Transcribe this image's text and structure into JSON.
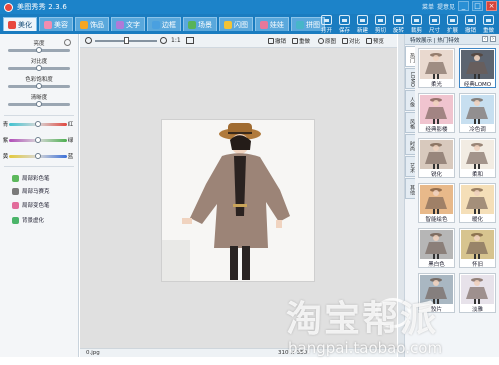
{
  "window": {
    "title": "美图秀秀 2.3.6",
    "menu_label": "菜单",
    "feedback_label": "提意见",
    "minimize": "_",
    "maximize": "□",
    "close": "×"
  },
  "tabs": [
    {
      "label": "美化",
      "color": "#e8483e",
      "active": true
    },
    {
      "label": "美容",
      "color": "#f08db0",
      "active": false
    },
    {
      "label": "饰品",
      "color": "#f5a623",
      "active": false
    },
    {
      "label": "文字",
      "color": "#b07ad8",
      "active": false
    },
    {
      "label": "边框",
      "color": "#4aa0e0",
      "active": false
    },
    {
      "label": "场景",
      "color": "#58b35a",
      "active": false
    },
    {
      "label": "闪图",
      "color": "#f2c335",
      "active": false
    },
    {
      "label": "娃娃",
      "color": "#e8789a",
      "active": false
    },
    {
      "label": "拼图",
      "color": "#47b6c9",
      "active": false
    }
  ],
  "tools": [
    "打开",
    "保存",
    "新建",
    "剪切",
    "旋转",
    "裁剪",
    "尺寸",
    "扩展",
    "撤销",
    "重做"
  ],
  "left_panel": {
    "sliders": [
      {
        "label": "亮度",
        "value": 0.5
      },
      {
        "label": "对比度",
        "value": 0.5
      },
      {
        "label": "色彩饱和度",
        "value": 0.5
      },
      {
        "label": "清晰度",
        "value": 0.5
      }
    ],
    "color_balance": [
      {
        "left": "青",
        "right": "红",
        "value": 0.5
      },
      {
        "left": "紫",
        "right": "绿",
        "value": 0.5
      },
      {
        "left": "黄",
        "right": "蓝",
        "value": 0.5
      }
    ],
    "effects": [
      {
        "label": "局部彩色笔",
        "color": "#5cb85c"
      },
      {
        "label": "局部马赛克",
        "color": "#7a7a7a"
      },
      {
        "label": "局部变色笔",
        "color": "#e26c9b"
      },
      {
        "label": "背景虚化",
        "color": "#4bb56a"
      }
    ]
  },
  "canvas_toolbar": {
    "ratio": "1:1",
    "undo": "撤销",
    "redo": "重做",
    "original": "原图",
    "compare": "对比",
    "preview": "预览"
  },
  "status": {
    "filename": "0.jpg",
    "size": "310 × 350"
  },
  "right_panel": {
    "title": "特效展示 | 热门特效",
    "vtabs": [
      "热门",
      "LOMO",
      "人像",
      "风格",
      "时尚",
      "艺术",
      "其他"
    ],
    "thumbs": [
      {
        "label": "柔光",
        "tint": "#e9d9cf"
      },
      {
        "label": "经典LOMO",
        "tint": "#5c6470"
      },
      {
        "label": "经典影楼",
        "tint": "#f0c4cf"
      },
      {
        "label": "冷色调",
        "tint": "#c7dff0"
      },
      {
        "label": "锐化",
        "tint": "#d8c9bd"
      },
      {
        "label": "柔和",
        "tint": "#f2ece3"
      },
      {
        "label": "智能绘色",
        "tint": "#e8b98a"
      },
      {
        "label": "暖化",
        "tint": "#f5dfb8"
      },
      {
        "label": "黑白色",
        "tint": "#b6b6b6"
      },
      {
        "label": "怀旧",
        "tint": "#d7c48f"
      },
      {
        "label": "胶片",
        "tint": "#a9b7c2"
      },
      {
        "label": "淡雅",
        "tint": "#e7e2ea"
      }
    ]
  },
  "watermark": {
    "brand": "淘宝帮派",
    "url": "bangpai.taobao.com"
  }
}
